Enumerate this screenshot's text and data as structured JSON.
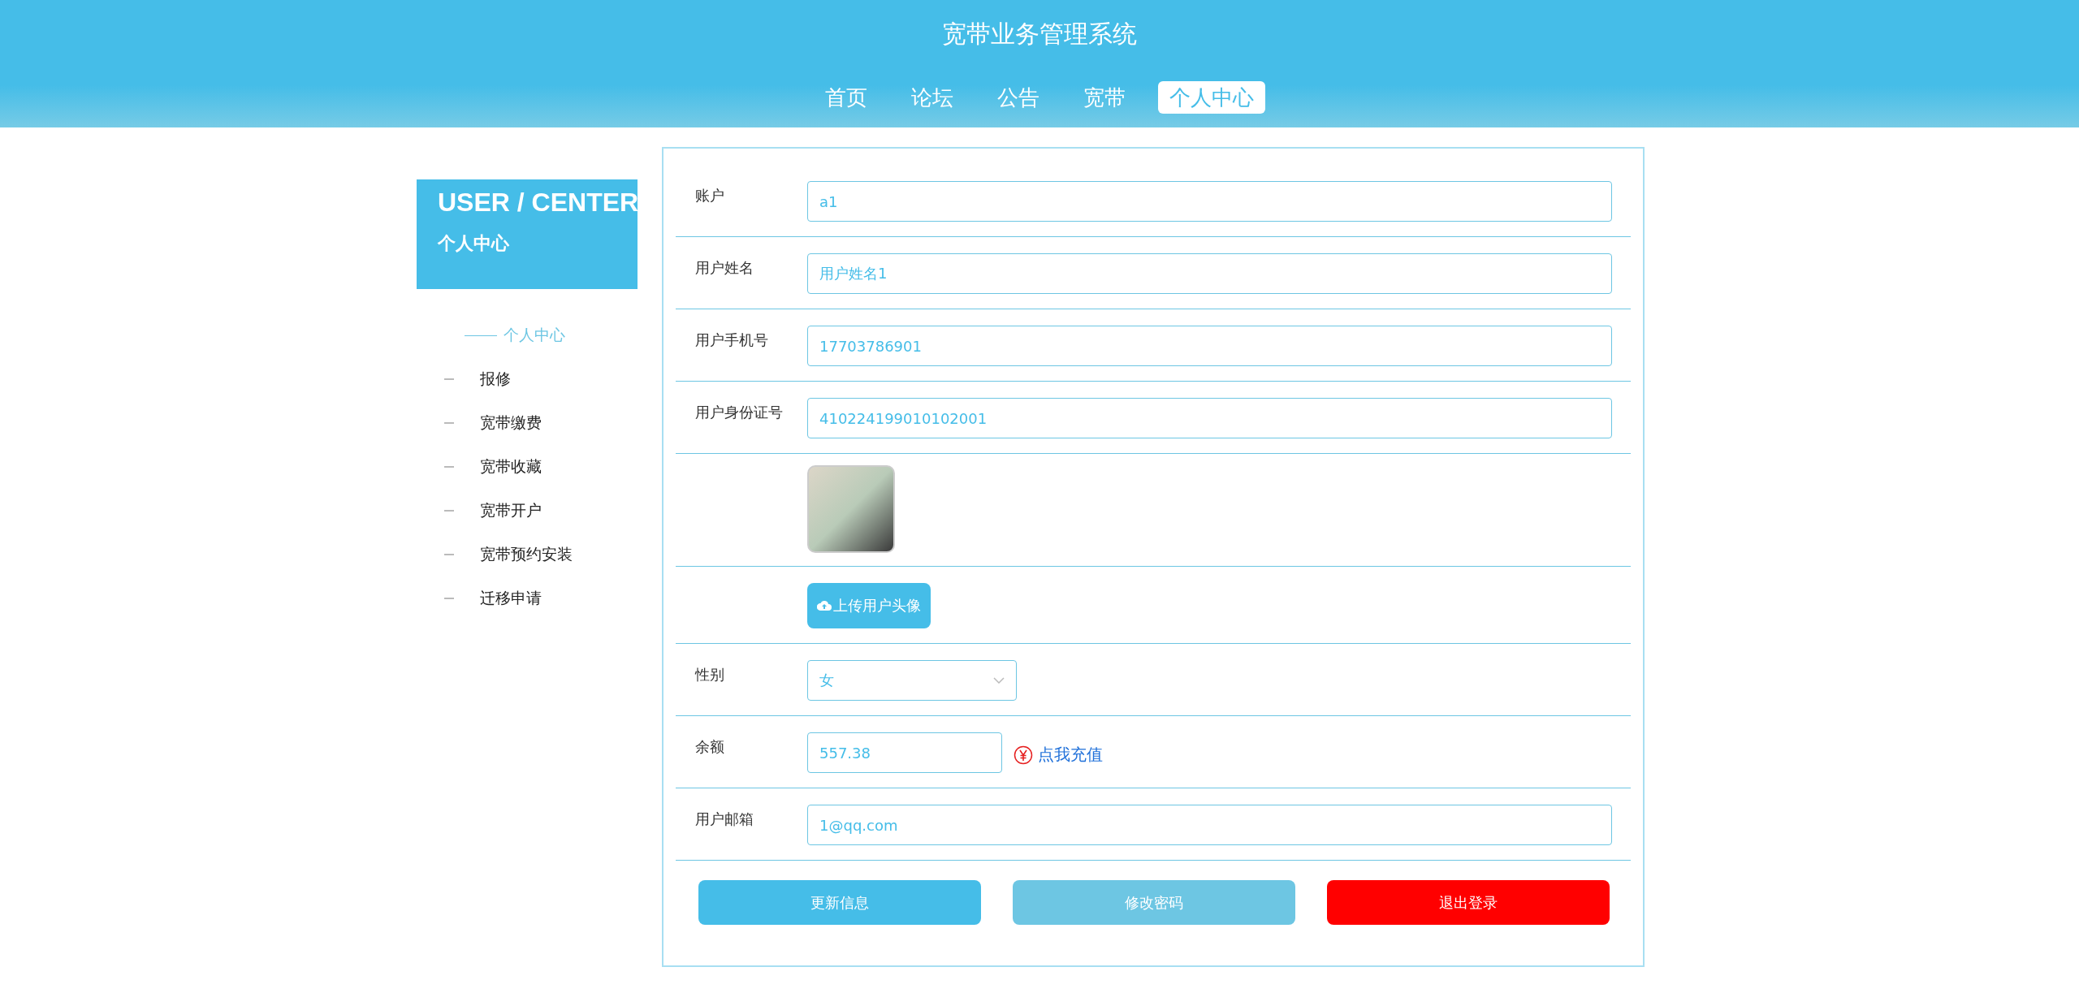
{
  "header": {
    "title": "宽带业务管理系统",
    "nav": [
      {
        "label": "首页",
        "selected": false
      },
      {
        "label": "论坛",
        "selected": false
      },
      {
        "label": "公告",
        "selected": false
      },
      {
        "label": "宽带",
        "selected": false
      },
      {
        "label": "个人中心",
        "selected": true
      }
    ]
  },
  "sidebar": {
    "title": "USER / CENTER",
    "subtitle": "个人中心",
    "items": [
      {
        "label": "个人中心",
        "selected": true
      },
      {
        "label": "报修",
        "selected": false
      },
      {
        "label": "宽带缴费",
        "selected": false
      },
      {
        "label": "宽带收藏",
        "selected": false
      },
      {
        "label": "宽带开户",
        "selected": false
      },
      {
        "label": "宽带预约安装",
        "selected": false
      },
      {
        "label": "迁移申请",
        "selected": false
      }
    ]
  },
  "form": {
    "fields": [
      {
        "kind": "text",
        "label": "账户",
        "value": "a1"
      },
      {
        "kind": "text",
        "label": "用户姓名",
        "value": "用户姓名1"
      },
      {
        "kind": "text",
        "label": "用户手机号",
        "value": "17703786901"
      },
      {
        "kind": "text",
        "label": "用户身份证号",
        "value": "410224199010102001"
      },
      {
        "kind": "image"
      },
      {
        "kind": "upload",
        "button": "上传用户头像"
      },
      {
        "kind": "select",
        "label": "性别",
        "value": "女"
      },
      {
        "kind": "balance",
        "label": "余额",
        "value": "557.38",
        "link": "点我充值"
      },
      {
        "kind": "text",
        "label": "用户邮箱",
        "value": "1@qq.com"
      }
    ],
    "buttons": [
      {
        "label": "更新信息",
        "color": "#45bde8"
      },
      {
        "label": "修改密码",
        "color": "#6dc6e3"
      },
      {
        "label": "退出登录",
        "color": "#ff0000"
      }
    ]
  }
}
